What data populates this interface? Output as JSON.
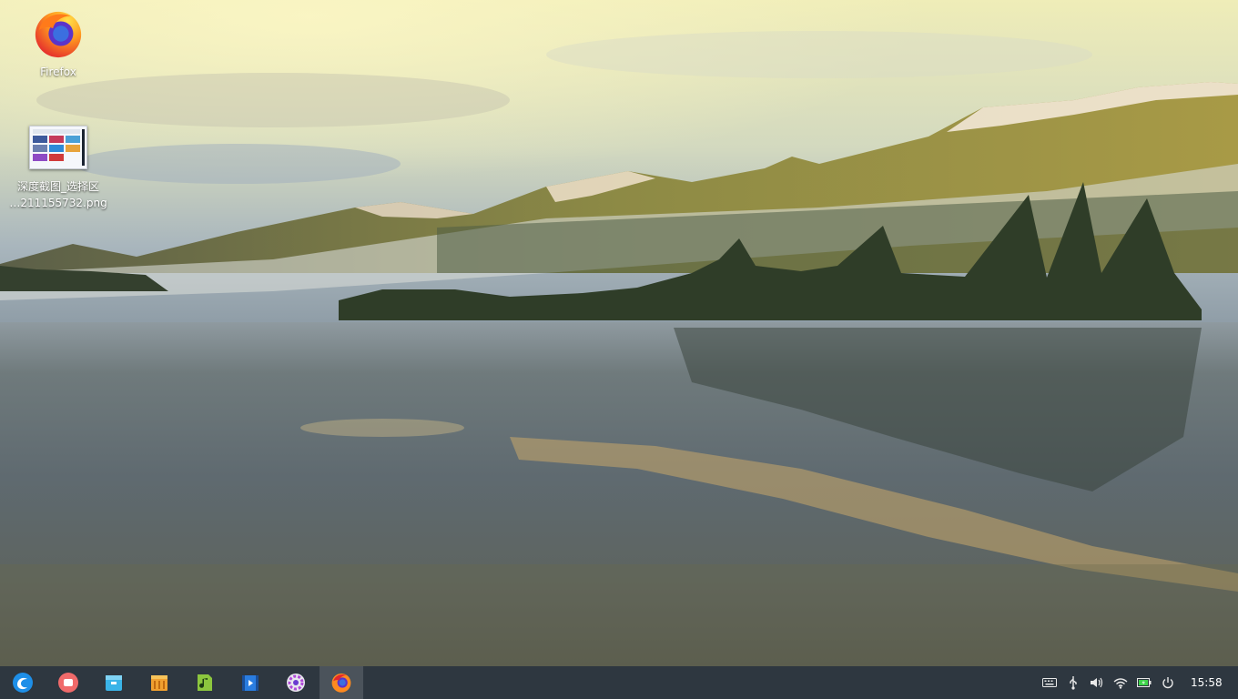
{
  "desktop": {
    "icons": [
      {
        "label": "Firefox"
      },
      {
        "label_line1": "深度截图_选择区",
        "label_line2": "…211155732.png"
      }
    ]
  },
  "taskbar": {
    "apps": [
      {
        "icon": "launcher-icon",
        "active": false
      },
      {
        "icon": "screen-recorder-icon",
        "active": false
      },
      {
        "icon": "file-manager-icon",
        "active": false
      },
      {
        "icon": "app-store-icon",
        "active": false
      },
      {
        "icon": "music-icon",
        "active": false
      },
      {
        "icon": "movie-icon",
        "active": false
      },
      {
        "icon": "settings-icon",
        "active": false
      },
      {
        "icon": "firefox-icon",
        "active": true
      }
    ],
    "tray": {
      "icons": [
        "keyboard-icon",
        "usb-icon",
        "volume-icon",
        "wifi-icon",
        "battery-icon",
        "power-icon"
      ],
      "clock": "15:58"
    }
  },
  "colors": {
    "taskbar_bg": "#1c2630",
    "desktop_text": "#ffffff"
  }
}
